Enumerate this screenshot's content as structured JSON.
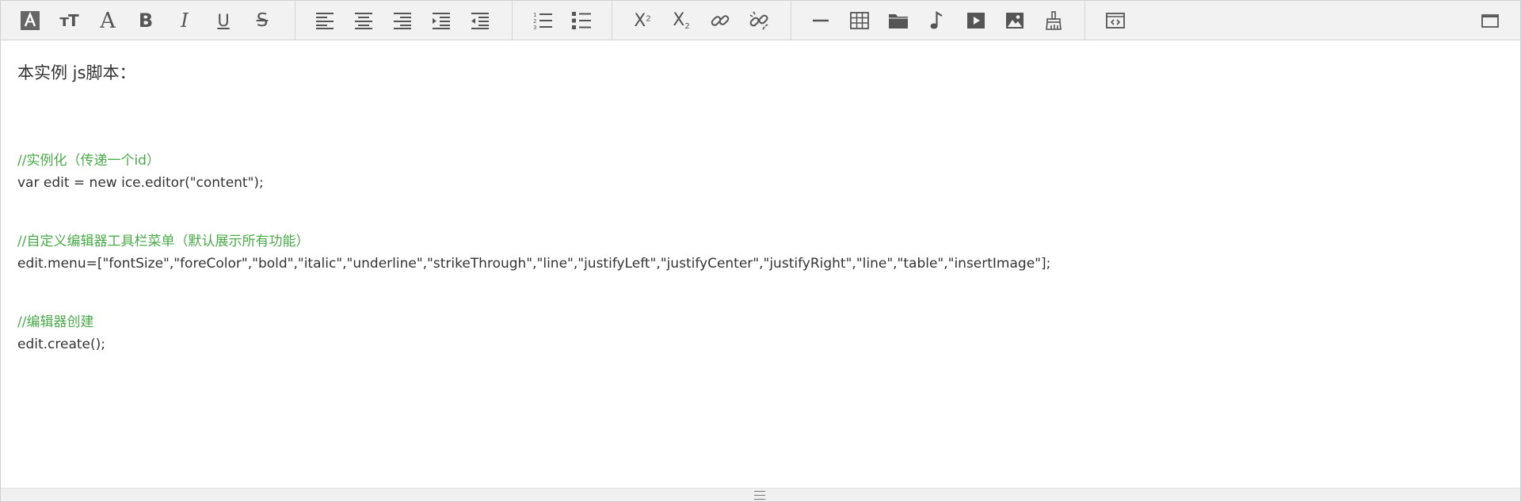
{
  "toolbar": {
    "buttons": [
      {
        "icon": "font-color-icon"
      },
      {
        "icon": "font-size-icon"
      },
      {
        "icon": "font-family-icon"
      },
      {
        "icon": "bold-icon"
      },
      {
        "icon": "italic-icon"
      },
      {
        "icon": "underline-icon"
      },
      {
        "icon": "strikethrough-icon"
      },
      {
        "icon": "align-left-icon"
      },
      {
        "icon": "align-center-icon"
      },
      {
        "icon": "align-right-icon"
      },
      {
        "icon": "indent-icon"
      },
      {
        "icon": "outdent-icon"
      },
      {
        "icon": "ordered-list-icon"
      },
      {
        "icon": "unordered-list-icon"
      },
      {
        "icon": "superscript-icon"
      },
      {
        "icon": "subscript-icon"
      },
      {
        "icon": "link-icon"
      },
      {
        "icon": "unlink-icon"
      },
      {
        "icon": "horizontal-line-icon"
      },
      {
        "icon": "table-icon"
      },
      {
        "icon": "folder-icon"
      },
      {
        "icon": "music-icon"
      },
      {
        "icon": "video-icon"
      },
      {
        "icon": "image-icon"
      },
      {
        "icon": "clear-format-icon"
      },
      {
        "icon": "source-code-icon"
      },
      {
        "icon": "fullscreen-icon"
      }
    ],
    "labels": {
      "superscript_glyph": "X",
      "superscript_digit": "2",
      "subscript_glyph": "X",
      "subscript_digit": "2",
      "font_size_glyph": "тT",
      "font_family_glyph": "A",
      "bold_glyph": "B",
      "italic_glyph": "I",
      "underline_glyph": "U",
      "strike_glyph": "S"
    }
  },
  "content": {
    "heading": "本实例 js脚本：",
    "lines": [
      {
        "kind": "comment",
        "text": "//实例化（传递一个id）"
      },
      {
        "kind": "code",
        "text": "var edit = new ice.editor(\"content\");"
      },
      {
        "kind": "comment",
        "text": "//自定义编辑器工具栏菜单（默认展示所有功能）"
      },
      {
        "kind": "code",
        "text": "edit.menu=[\"fontSize\",\"foreColor\",\"bold\",\"italic\",\"underline\",\"strikeThrough\",\"line\",\"justifyLeft\",\"justifyCenter\",\"justifyRight\",\"line\",\"table\",\"insertImage\"];"
      },
      {
        "kind": "comment",
        "text": "//编辑器创建"
      },
      {
        "kind": "code",
        "text": "edit.create();"
      }
    ]
  },
  "colors": {
    "comment": "#4aaa4a",
    "text": "#333333",
    "icon": "#595959",
    "toolbar_bg": "#f2f2f2"
  }
}
